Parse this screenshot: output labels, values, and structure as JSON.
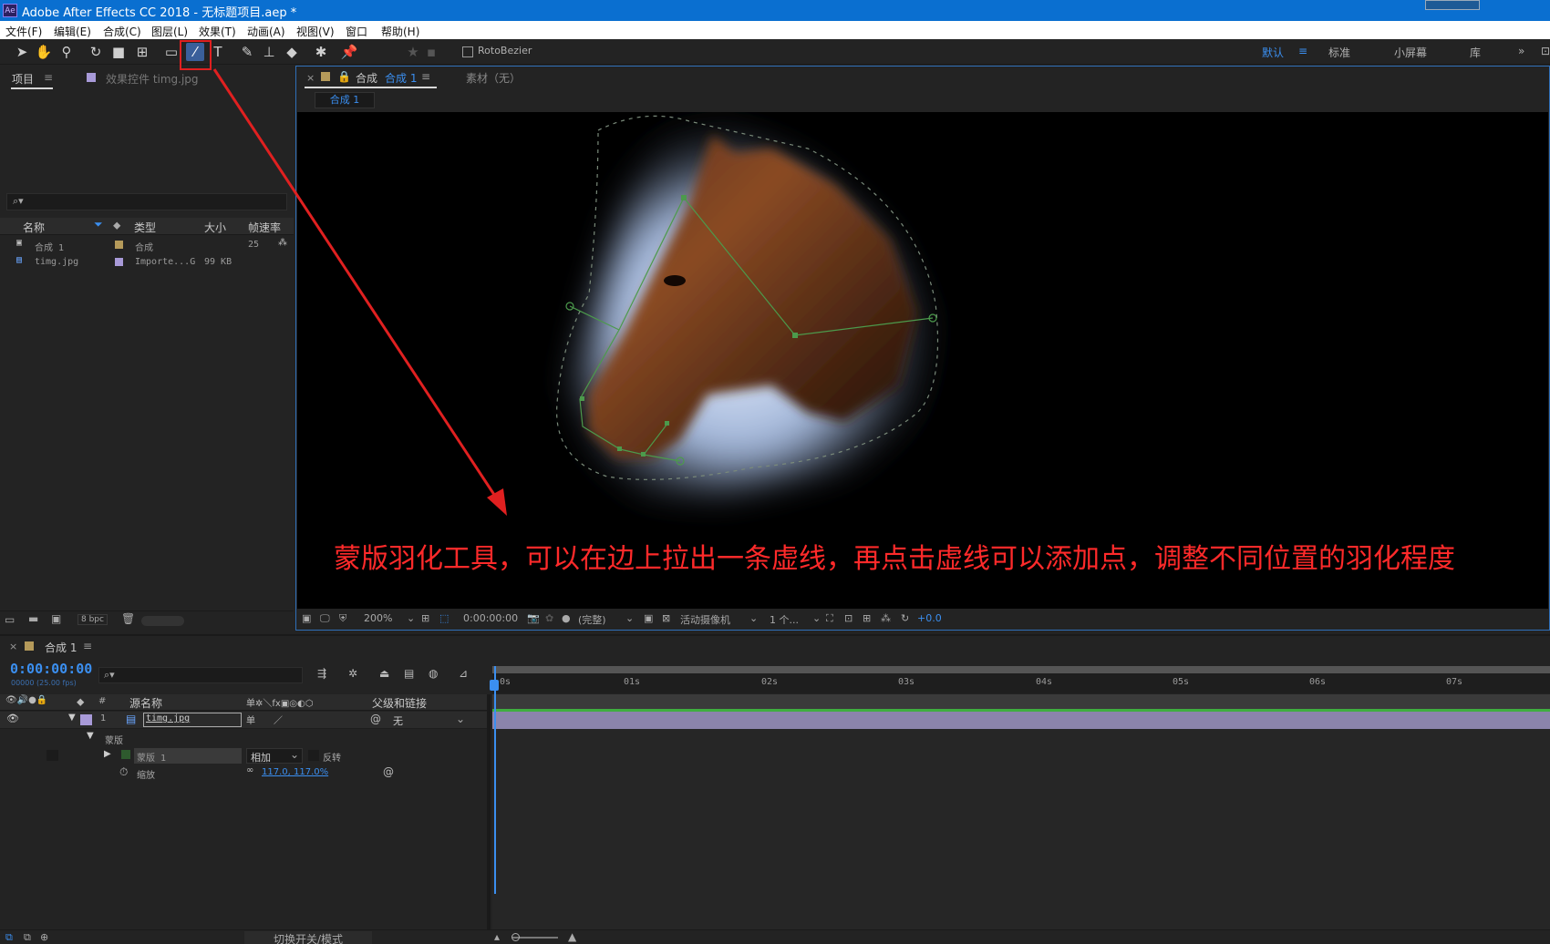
{
  "window": {
    "title": "Adobe After Effects CC 2018 - 无标题项目.aep *",
    "app_icon": "Ae"
  },
  "menu": [
    "文件(F)",
    "编辑(E)",
    "合成(C)",
    "图层(L)",
    "效果(T)",
    "动画(A)",
    "视图(V)",
    "窗口",
    "帮助(H)"
  ],
  "toolbar": {
    "tools": [
      "selection-tool",
      "hand-tool",
      "zoom-tool",
      "rotate-tool",
      "camera-tool",
      "pan-behind-tool",
      "rectangle-tool",
      "mask-feather-tool",
      "type-tool",
      "brush-tool",
      "clone-stamp-tool",
      "eraser-tool",
      "roto-brush-tool",
      "puppet-pin-tool"
    ],
    "rotobezier_label": "RotoBezier",
    "workspaces": [
      "默认",
      "标准",
      "小屏幕",
      "库"
    ],
    "more": "»"
  },
  "project_panel": {
    "tab_project": "项目",
    "tab_effects": "效果控件 timg.jpg",
    "search_icon": "⌕▾",
    "columns": [
      "名称",
      "类型",
      "大小",
      "帧速率"
    ],
    "items": [
      {
        "name": "合成 1",
        "type": "合成",
        "size": "",
        "fps": "25",
        "label_color": "#b59a5a"
      },
      {
        "name": "timg.jpg",
        "type": "Importe...G",
        "size": "99 KB",
        "fps": "",
        "label_color": "#a89ad8"
      }
    ],
    "bpc": "8 bpc"
  },
  "composition_panel": {
    "tab_label": "合成",
    "tab_comp": "合成 1",
    "tab_footage": "素材（无）",
    "breadcrumb": "合成 1",
    "annotation": "蒙版羽化工具，可以在边上拉出一条虚线，再点击虚线可以添加点，调整不同位置的羽化程度",
    "bottom_bar": {
      "zoom": "200%",
      "timecode": "0:00:00:00",
      "resolution": "(完整)",
      "camera": "活动摄像机",
      "views": "1 个...",
      "exposure": "+0.0"
    }
  },
  "timeline": {
    "tab": "合成 1",
    "timecode": "0:00:00:00",
    "frame_info": "00000 (25.00 fps)",
    "search_icon": "⌕▾",
    "headers": {
      "hash": "#",
      "source_name": "源名称",
      "parent": "父级和链接"
    },
    "layer": {
      "index": "1",
      "name": "timg.jpg",
      "parent": "无"
    },
    "mask_group": "蒙版",
    "mask": {
      "name": "蒙版 1",
      "mode": "相加",
      "invert": "反转"
    },
    "scale": {
      "label": "缩放",
      "value": "117.0, 117.0%"
    },
    "ruler_ticks": [
      "0s",
      "01s",
      "02s",
      "03s",
      "04s",
      "05s",
      "06s",
      "07s"
    ],
    "bottom_label": "切换开关/模式"
  },
  "colors": {
    "accent": "#3b8ff0",
    "title_bar": "#0a6fd0",
    "annotation_red": "#ff2a2a"
  }
}
